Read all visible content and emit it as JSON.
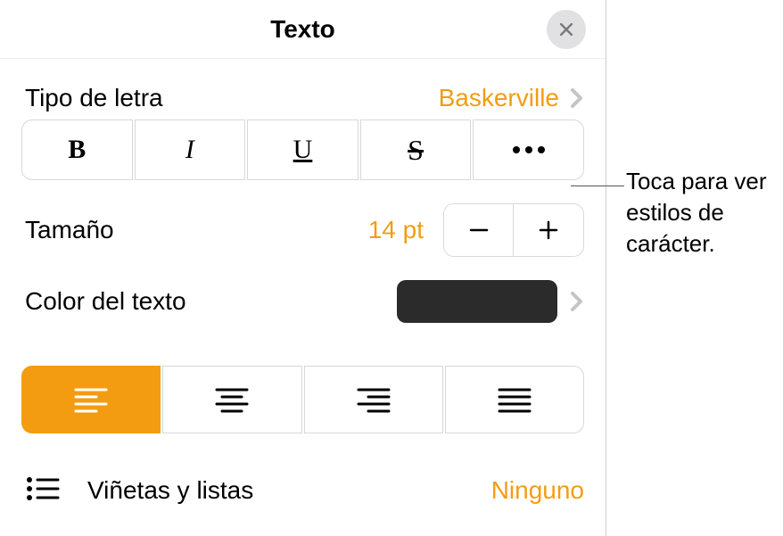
{
  "header": {
    "title": "Texto"
  },
  "font": {
    "label": "Tipo de letra",
    "value": "Baskerville"
  },
  "styles": {
    "bold": "B",
    "italic": "I",
    "underline": "U",
    "strike": "S"
  },
  "size": {
    "label": "Tamaño",
    "value": "14 pt"
  },
  "color": {
    "label": "Color del texto",
    "swatch": "#2b2b2b"
  },
  "bullets": {
    "label": "Viñetas y listas",
    "value": "Ninguno"
  },
  "callout": {
    "text": "Toca para ver estilos de carácter."
  },
  "colors": {
    "accent": "#f39c12"
  }
}
